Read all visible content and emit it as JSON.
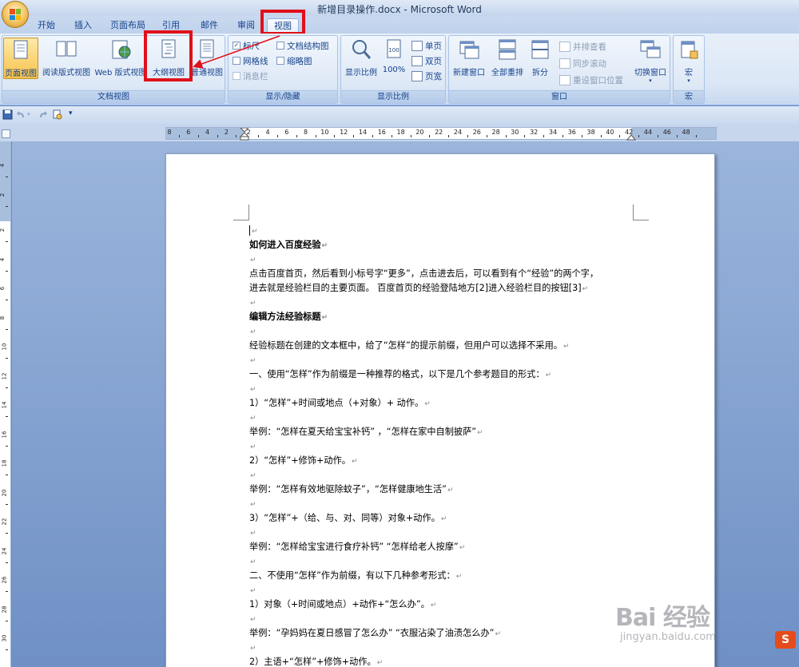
{
  "window": {
    "title": "新增目录操作.docx - Microsoft Word"
  },
  "tabs": [
    {
      "label": "开始"
    },
    {
      "label": "插入"
    },
    {
      "label": "页面布局"
    },
    {
      "label": "引用"
    },
    {
      "label": "邮件"
    },
    {
      "label": "审阅"
    },
    {
      "label": "视图",
      "active": true
    }
  ],
  "ribbon": {
    "document_views": {
      "label": "文档视图",
      "buttons": [
        "页面视图",
        "阅读版式视图",
        "Web 版式视图",
        "大纲视图",
        "普通视图"
      ]
    },
    "show_hide": {
      "label": "显示/隐藏",
      "items": [
        {
          "label": "标尺",
          "checked": true
        },
        {
          "label": "文档结构图",
          "checked": false
        },
        {
          "label": "网格线",
          "checked": false
        },
        {
          "label": "缩略图",
          "checked": false
        },
        {
          "label": "消息栏",
          "checked": false,
          "disabled": true
        }
      ]
    },
    "zoom": {
      "label": "显示比例",
      "buttons": [
        "显示比例",
        "100%"
      ],
      "small": [
        "单页",
        "双页",
        "页宽"
      ]
    },
    "window_group": {
      "label": "窗口",
      "buttons": [
        "新建窗口",
        "全部重排",
        "拆分"
      ],
      "small": [
        "并排查看",
        "同步滚动",
        "重设窗口位置"
      ],
      "switch": "切换窗口"
    },
    "macros": {
      "label": "宏",
      "button": "宏"
    }
  },
  "ruler_numbers": [
    "8",
    "6",
    "4",
    "2",
    "2",
    "4",
    "6",
    "8",
    "10",
    "12",
    "14",
    "16",
    "18",
    "20",
    "22",
    "24",
    "26",
    "28",
    "30",
    "32",
    "34",
    "36",
    "38",
    "40",
    "42",
    "44",
    "46",
    "48"
  ],
  "vruler_numbers": [
    "4",
    "2",
    "2",
    "4",
    "6",
    "8",
    "10",
    "12",
    "14",
    "16",
    "18",
    "20",
    "22",
    "24",
    "26",
    "28",
    "30"
  ],
  "document": {
    "heading1": "如何进入百度经验",
    "p1_line1": "点击百度首页，然后看到小标号字“更多”，点击进去后，可以看到有个“经验”的两个字，",
    "p1_line2": "进去就是经验栏目的主要页面。 百度首页的经验登陆地方[2]进入经验栏目的按钮[3]",
    "heading2": "编辑方法经验标题",
    "p2": "经验标题在创建的文本框中，给了“怎样”的提示前缀，但用户可以选择不采用。",
    "p3": "一、使用“怎样”作为前缀是一种推荐的格式，以下是几个参考题目的形式：",
    "p4": "1）“怎样”+时间或地点（+对象）+ 动作。",
    "p5": "举例：“怎样在夏天给宝宝补钙” ，“怎样在家中自制披萨”",
    "p6": "2）“怎样”+修饰+动作。",
    "p7": "举例：“怎样有效地驱除蚊子”，“怎样健康地生活”",
    "p8": "3）“怎样”+（给、与、对、同等）对象+动作。",
    "p9": "举例：“怎样给宝宝进行食疗补钙”  “怎样给老人按摩”",
    "p10": "二、不使用“怎样”作为前缀，有以下几种参考形式：",
    "p11": "1）对象（+时间或地点）+动作+“怎么办”。",
    "p12": "举例：“孕妈妈在夏日感冒了怎么办”  “衣服沾染了油渍怎么办”",
    "p13": "2）主语+“怎样”+修饰+动作。"
  },
  "watermark": {
    "main": "Bai 经验",
    "sub": "jingyan.baidu.com"
  },
  "ime_badge": "S"
}
